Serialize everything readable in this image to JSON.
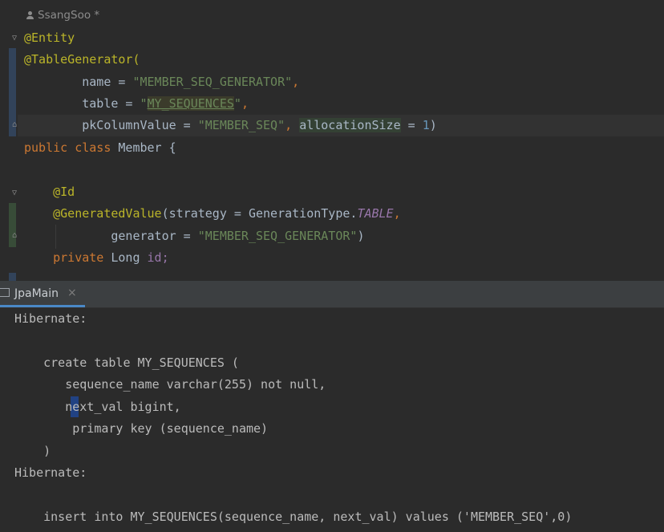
{
  "editor": {
    "author": "SsangSoo *",
    "lines": {
      "entity": "@Entity",
      "tablegen": "@TableGenerator(",
      "name_key": "name = ",
      "name_val": "\"MEMBER_SEQ_GENERATOR\"",
      "comma": ",",
      "table_key": "table = ",
      "table_q1": "\"",
      "table_val": "MY_SEQUENCES",
      "table_q2": "\"",
      "pk_key": "pkColumnValue = ",
      "pk_val": "\"MEMBER_SEQ\"",
      "alloc_key": "allocationSize",
      "alloc_eq": " = ",
      "alloc_val": "1",
      "close_paren": ")",
      "public": "public",
      "class": "class",
      "member": "Member {",
      "id_ann": "@Id",
      "gen_ann": "@GeneratedValue",
      "strategy": "(strategy = GenerationType.",
      "table_enum": "TABLE",
      "generator_key": "generator = ",
      "generator_val": "\"MEMBER_SEQ_GENERATOR\"",
      "private": "private",
      "long": "Long",
      "id": "id;"
    }
  },
  "console_tab": {
    "title": "JpaMain",
    "close": "×"
  },
  "console": {
    "lines": [
      "Hibernate:",
      "    create table MY_SEQUENCES (",
      "       sequence_name varchar(255) not null,",
      "       next_val bigint,",
      "        primary key (sequence_name)",
      "    )",
      "Hibernate:",
      "    insert into MY_SEQUENCES(sequence_name, next_val) values ('MEMBER_SEQ',0)"
    ]
  }
}
